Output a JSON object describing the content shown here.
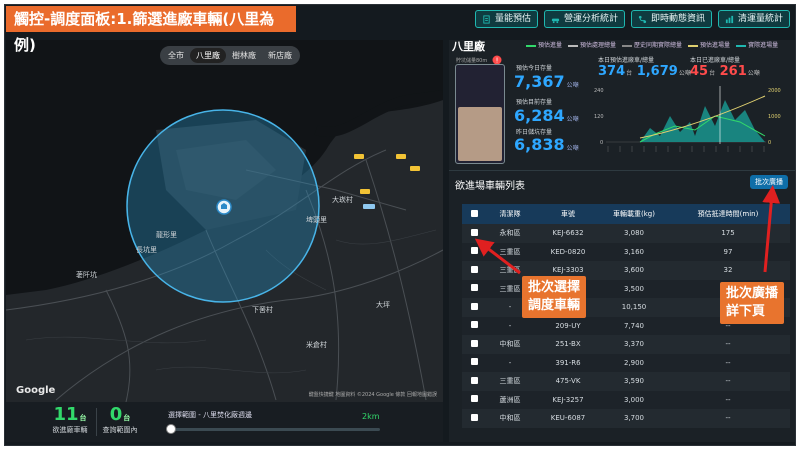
{
  "slide_title": "觸控-調度面板:1.篩選進廠車輛(八里為例)",
  "top_buttons": [
    {
      "label": "量能預估",
      "icon": "clipboard-icon"
    },
    {
      "label": "營運分析統計",
      "icon": "car-icon"
    },
    {
      "label": "即時動態資訊",
      "icon": "route-icon"
    },
    {
      "label": "清運量統計",
      "icon": "bar-chart-icon"
    }
  ],
  "map": {
    "filters": [
      "全市",
      "八里廠",
      "樹林廠",
      "新店廠"
    ],
    "active_filter": "八里廠",
    "labels": [
      "長坑里",
      "龍形里",
      "埤頭里",
      "大崁村",
      "荖阡坑",
      "下罟村",
      "米倉村",
      "大坪"
    ],
    "google": "Google",
    "attribution": "鍵盤快捷鍵  地圖資料 ©2024 Google  條款  回報地圖錯誤"
  },
  "bottom_stats": {
    "incoming": {
      "value": "11",
      "unit": "台",
      "label": "欲進廠車輛"
    },
    "in_range": {
      "value": "0",
      "unit": "台",
      "label": "查詢範圍內"
    },
    "range_label": "選擇範圍 - 八里焚化廠週邊",
    "range_km": "2km",
    "range_fraction": 0.0
  },
  "right_panel": {
    "title": "八里廠",
    "legend": [
      "預估進量",
      "預估處理總量",
      "歷史同期實際總量",
      "預估進場量",
      "實際進場量"
    ],
    "silo_caption": "貯坑儲量80m",
    "silo_fill_fraction": 0.55,
    "metrics": [
      {
        "label": "預估今日存量",
        "value": "7,367",
        "unit": "公噸"
      },
      {
        "label": "預估目前存量",
        "value": "6,284",
        "unit": "公噸"
      },
      {
        "label": "昨日儲坑存量",
        "value": "6,838",
        "unit": "公噸"
      }
    ],
    "today_vehicles": {
      "label": "本日預估進廠車/總量",
      "trucks": "374",
      "trucks_unit": "台",
      "tons": "1,679",
      "tons_unit": "公噸"
    },
    "today_actual": {
      "label": "本日已進廠車/總量",
      "trucks": "45",
      "trucks_unit": "台",
      "tons": "261",
      "tons_unit": "公噸"
    },
    "chart_axis_left": [
      "240",
      "120",
      "0"
    ],
    "chart_axis_right": [
      "2000",
      "1000",
      "0"
    ]
  },
  "vehicle_list": {
    "title": "欲進場車輛列表",
    "batch_button": "批次廣播",
    "headers": [
      "清潔隊",
      "車號",
      "車輛載重(kg)",
      "預估抵達時間(min)"
    ],
    "rows": [
      [
        "永和區",
        "KEJ-6632",
        "3,080",
        "175"
      ],
      [
        "三重區",
        "KED-0820",
        "3,160",
        "97"
      ],
      [
        "三重區",
        "KEJ-3303",
        "3,600",
        "32"
      ],
      [
        "三重區",
        "KEJ-3282",
        "3,500",
        "--"
      ],
      [
        "-",
        "-",
        "10,150",
        "--"
      ],
      [
        "-",
        "209-UY",
        "7,740",
        "--"
      ],
      [
        "中和區",
        "251-BX",
        "3,370",
        "--"
      ],
      [
        "-",
        "391-R6",
        "2,900",
        "--"
      ],
      [
        "三重區",
        "475-VK",
        "3,590",
        "--"
      ],
      [
        "蘆洲區",
        "KEJ-3257",
        "3,000",
        "--"
      ],
      [
        "中和區",
        "KEU-6087",
        "3,700",
        "--"
      ]
    ]
  },
  "callouts": {
    "batch_select": "批次選擇\n調度車輛",
    "batch_broadcast": "批次廣播\n詳下頁"
  },
  "colors": {
    "accent_teal": "#1fb7b0",
    "accent_green": "#32d96b",
    "accent_blue": "#2ea7ff",
    "warn_orange": "#e8742e",
    "alert_red": "#ff4b4b",
    "callout_red_arrow": "#e02020"
  }
}
